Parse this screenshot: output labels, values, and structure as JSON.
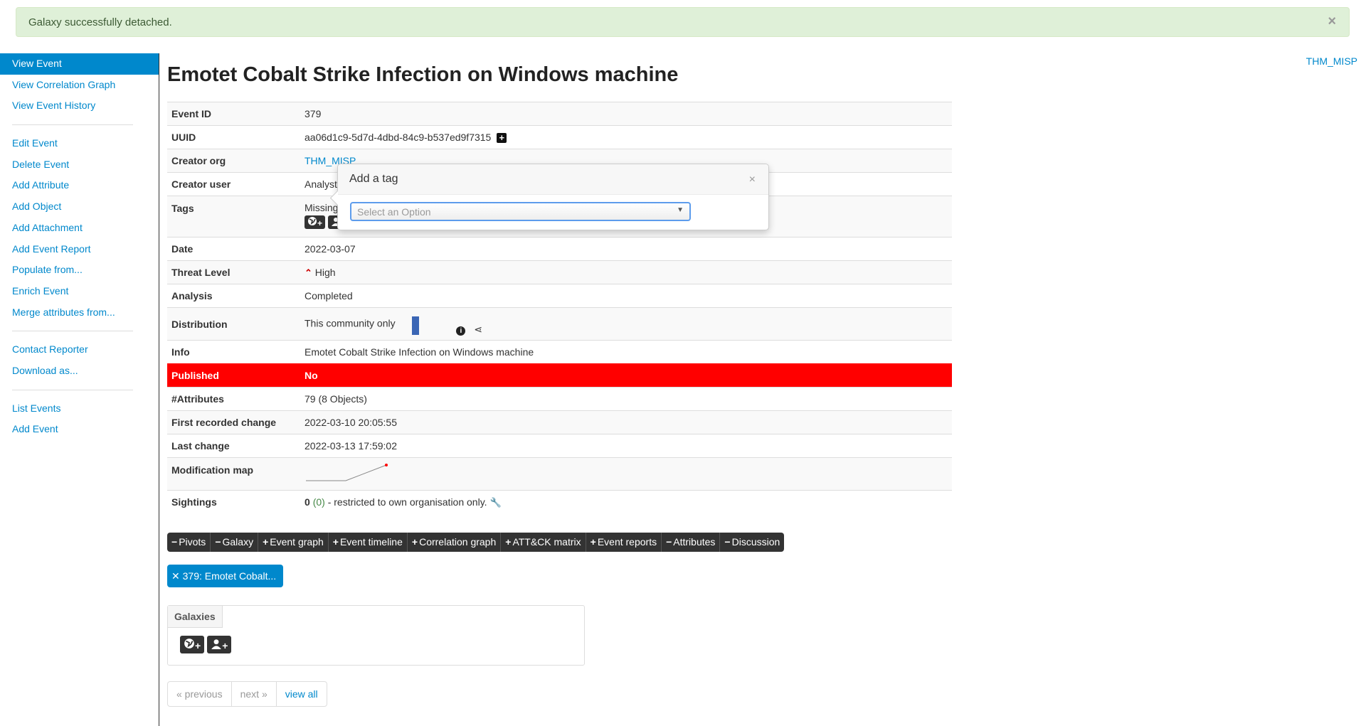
{
  "alert": {
    "message": "Galaxy successfully detached.",
    "close": "×"
  },
  "org_link": "THM_MISP",
  "sidebar": {
    "groups": [
      [
        "View Event",
        "View Correlation Graph",
        "View Event History"
      ],
      [
        "Edit Event",
        "Delete Event",
        "Add Attribute",
        "Add Object",
        "Add Attachment",
        "Add Event Report",
        "Populate from...",
        "Enrich Event",
        "Merge attributes from..."
      ],
      [
        "Contact Reporter",
        "Download as..."
      ],
      [
        "List Events",
        "Add Event"
      ]
    ]
  },
  "title": "Emotet Cobalt Strike Infection on Windows machine",
  "meta": {
    "event_id": {
      "k": "Event ID",
      "v": "379"
    },
    "uuid": {
      "k": "UUID",
      "v": "aa06d1c9-5d7d-4dbd-84c9-b537ed9f7315",
      "icon": "+"
    },
    "creator_org": {
      "k": "Creator org",
      "v": "THM_MISP"
    },
    "creator_user": {
      "k": "Creator user",
      "v": "Analyst@"
    },
    "tags": {
      "k": "Tags",
      "v": "Missing"
    },
    "date": {
      "k": "Date",
      "v": "2022-03-07"
    },
    "threat": {
      "k": "Threat Level",
      "v": "High",
      "icon": "⌃"
    },
    "analysis": {
      "k": "Analysis",
      "v": "Completed"
    },
    "distribution": {
      "k": "Distribution",
      "v": "This community only",
      "info": "i",
      "share": "⋖"
    },
    "info": {
      "k": "Info",
      "v": "Emotet Cobalt Strike Infection on Windows machine"
    },
    "published": {
      "k": "Published",
      "v": "No"
    },
    "attributes": {
      "k": "#Attributes",
      "v": "79 (8 Objects)"
    },
    "first_change": {
      "k": "First recorded change",
      "v": "2022-03-10 20:05:55"
    },
    "last_change": {
      "k": "Last change",
      "v": "2022-03-13 17:59:02"
    },
    "modmap": {
      "k": "Modification map"
    },
    "sightings": {
      "k": "Sightings",
      "count": "0",
      "own": "(0)",
      "text": "- restricted to own organisation only."
    }
  },
  "tabs": [
    {
      "sym": "−",
      "label": "Pivots"
    },
    {
      "sym": "−",
      "label": "Galaxy"
    },
    {
      "sym": "+",
      "label": "Event graph"
    },
    {
      "sym": "+",
      "label": "Event timeline"
    },
    {
      "sym": "+",
      "label": "Correlation graph"
    },
    {
      "sym": "+",
      "label": "ATT&CK matrix"
    },
    {
      "sym": "+",
      "label": "Event reports"
    },
    {
      "sym": "−",
      "label": "Attributes"
    },
    {
      "sym": "−",
      "label": "Discussion"
    }
  ],
  "pivot_pill": "✕ 379: Emotet Cobalt...",
  "galaxies": {
    "header": "Galaxies"
  },
  "pager": {
    "previous": "« previous",
    "next": "next »",
    "view_all": "view all"
  },
  "popover": {
    "title": "Add a tag",
    "close": "×",
    "placeholder": "Select an Option",
    "arrow": "▼"
  },
  "colors": {
    "primary": "#0088cc",
    "published_no": "#ff0000",
    "alert_bg": "#dff0d8",
    "distribution_bar": "#3b66b5"
  }
}
